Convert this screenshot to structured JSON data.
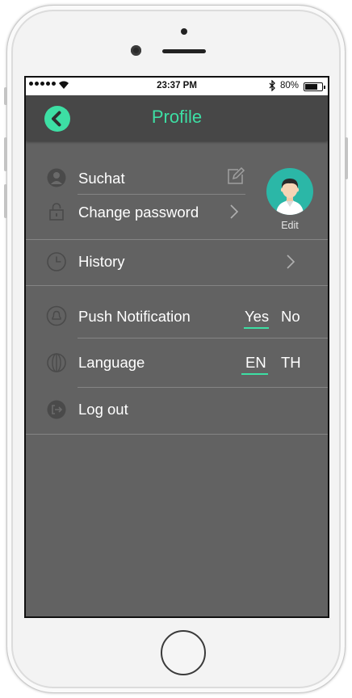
{
  "status_bar": {
    "time": "23:37 PM",
    "battery": "80%"
  },
  "header": {
    "title": "Profile",
    "back_icon": "chevron-left-icon",
    "accent_color": "#3ddfa4"
  },
  "profile": {
    "username": "Suchat",
    "change_password": "Change password",
    "avatar_edit": "Edit"
  },
  "menu": {
    "history": "History",
    "push_notification": {
      "label": "Push Notification",
      "options": [
        "Yes",
        "No"
      ],
      "selected": "Yes"
    },
    "language": {
      "label": "Language",
      "options": [
        "EN",
        "TH"
      ],
      "selected": "EN"
    },
    "logout": "Log out"
  }
}
